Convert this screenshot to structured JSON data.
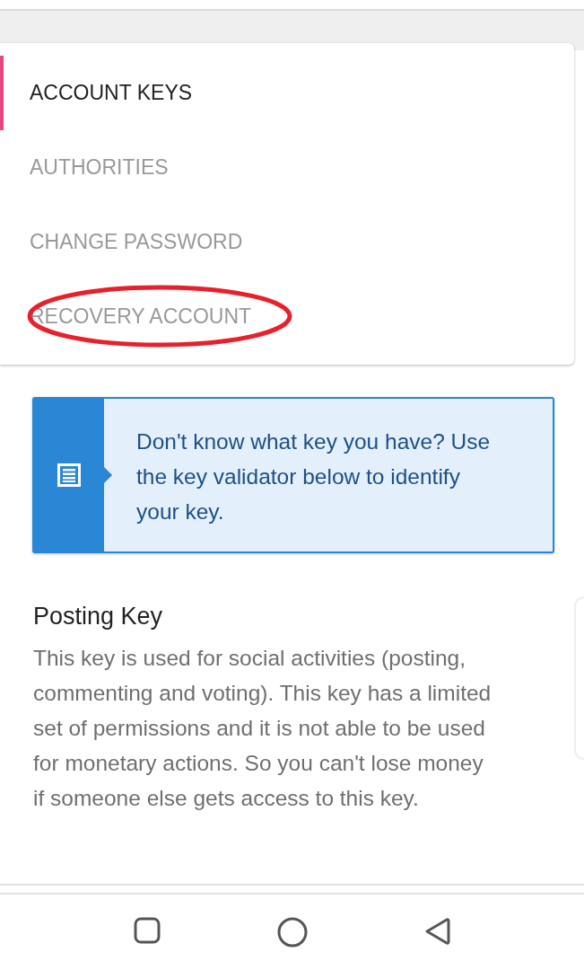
{
  "tabs": [
    {
      "label": "ACCOUNT KEYS",
      "selected": true
    },
    {
      "label": "AUTHORITIES",
      "selected": false
    },
    {
      "label": "CHANGE PASSWORD",
      "selected": false
    },
    {
      "label": "RECOVERY ACCOUNT",
      "selected": false,
      "circled": true
    }
  ],
  "info": {
    "text": "Don't know what key you have? Use the key validator below to identify your key."
  },
  "section": {
    "title": "Posting Key",
    "text": "This key is used for social activities (posting, commenting and voting). This key has a limited set of permissions and it is not able to be used for monetary actions. So you can't lose money if someone else gets access to this key."
  }
}
